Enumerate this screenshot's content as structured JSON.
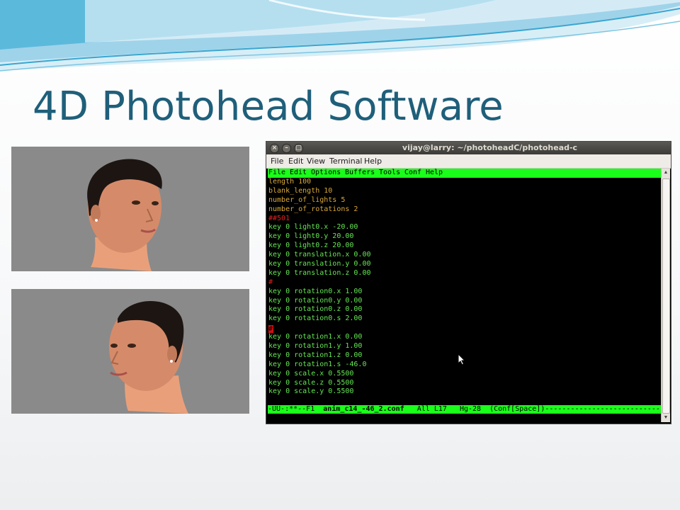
{
  "slide": {
    "title": "4D Photohead Software",
    "colors": {
      "title": "#1f5f7a",
      "swoosh": "#4fb3d6",
      "photo_bg": "#8a8a8a"
    }
  },
  "photos": [
    {
      "name": "head-render-facing-right",
      "facing": "right"
    },
    {
      "name": "head-render-facing-left",
      "facing": "left"
    }
  ],
  "terminal": {
    "title": "vijay@larry: ~/photoheadC/photohead-c",
    "window_buttons": [
      "close-icon",
      "minimize-icon",
      "maximize-icon"
    ],
    "menu": [
      "File",
      "Edit",
      "View",
      "Terminal",
      "Help"
    ],
    "emacs_menu": [
      "File",
      "Edit",
      "Options",
      "Buffers",
      "Tools",
      "Conf",
      "Help"
    ],
    "lines": [
      "length 100",
      "blank_length 10",
      "number_of_lights 5",
      "number_of_rotations 2",
      "##501",
      "key 0 light0.x -20.00",
      "key 0 light0.y 20.00",
      "key 0 light0.z 20.00",
      "key 0 translation.x 0.00",
      "key 0 translation.y 0.00",
      "key 0 translation.z 0.00",
      "#",
      "key 0 rotation0.x 1.00",
      "key 0 rotation0.y 0.00",
      "key 0 rotation0.z 0.00",
      "key 0 rotation0.s 2.00",
      "#",
      "key 0 rotation1.x 0.00",
      "key 0 rotation1.y 1.00",
      "key 0 rotation1.z 0.00",
      "key 0 rotation1.s -46.0",
      "key 0 scale.x 0.5500",
      "key 0 scale.z 0.5500",
      "key 0 scale.y 0.5500"
    ],
    "modeline": {
      "prefix": "-UU-:**--F1  ",
      "buffer": "anim_c14_-46_2.conf",
      "suffix": "   All L17   Hg-28  (Conf[Space])----------------------------------"
    },
    "colors": {
      "background": "#000000",
      "emacs_bar": "#1aff1a",
      "keyword": "#63e852",
      "variable": "#d8a83a",
      "comment": "#e02020"
    }
  }
}
